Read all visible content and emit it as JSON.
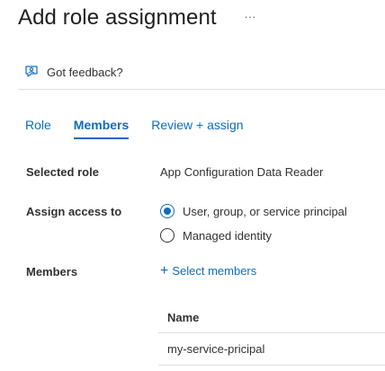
{
  "header": {
    "title": "Add role assignment",
    "more_label": "···"
  },
  "feedback": {
    "label": "Got feedback?",
    "icon": "feedback-person-icon"
  },
  "tabs": [
    {
      "label": "Role",
      "active": false
    },
    {
      "label": "Members",
      "active": true
    },
    {
      "label": "Review + assign",
      "active": false
    }
  ],
  "form": {
    "selected_role_label": "Selected role",
    "selected_role_value": "App Configuration Data Reader",
    "assign_access_label": "Assign access to",
    "options": [
      {
        "label": "User, group, or service principal",
        "checked": true
      },
      {
        "label": "Managed identity",
        "checked": false
      }
    ],
    "members_label": "Members",
    "select_members": {
      "plus": "+",
      "label": "Select members"
    }
  },
  "members_table": {
    "header": "Name",
    "rows": [
      "my-service-pricipal"
    ]
  },
  "colors": {
    "accent": "#0f6cbd",
    "text": "#323130",
    "divider": "#e1dfdd"
  }
}
